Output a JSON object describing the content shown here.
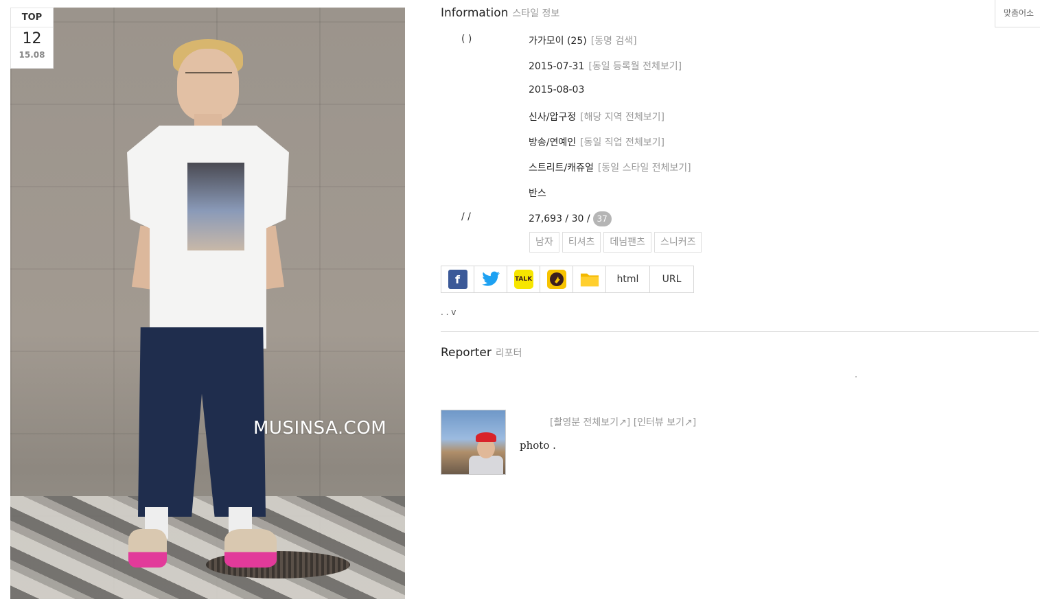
{
  "photo": {
    "watermark": "MUSINSA.COM",
    "badge": {
      "label": "TOP",
      "rank": "12",
      "date": "15.08"
    }
  },
  "info": {
    "title": "Information",
    "subtitle": "스타일 정보",
    "corner_button": "맞춤어소",
    "rows": [
      {
        "label": "(    )",
        "value": "가가모이 (25)",
        "link": "[동명 검색]"
      },
      {
        "label": "",
        "value": "2015-07-31",
        "link": "[동일 등록월 전체보기]"
      },
      {
        "label": "",
        "value": "2015-08-03",
        "link": ""
      },
      {
        "label": "",
        "value": "신사/압구정",
        "link": "[해당 지역 전체보기]"
      },
      {
        "label": "",
        "value": "방송/연예인",
        "link": "[동일 직업 전체보기]"
      },
      {
        "label": "",
        "value": "스트리트/캐쥬얼",
        "link": "[동일 스타일 전체보기]"
      },
      {
        "label": "",
        "value": "반스",
        "link": ""
      },
      {
        "label": "/     /",
        "value": "27,693 / 30 /",
        "link": "",
        "badge": "37"
      }
    ],
    "tags": [
      "남자",
      "티셔츠",
      "데님팬츠",
      "스니커즈"
    ],
    "share": {
      "icons": [
        "facebook-icon",
        "twitter-icon",
        "kakaotalk-icon",
        "kakaostory-icon",
        "folder-icon"
      ],
      "html_label": "html",
      "url_label": "URL"
    },
    "more_toggle": ".                 . v"
  },
  "reporter": {
    "title": "Reporter",
    "subtitle": "리포터",
    "links": "[촬영분 전체보기↗] [인터뷰 보기↗]",
    "desc": "photo ."
  }
}
